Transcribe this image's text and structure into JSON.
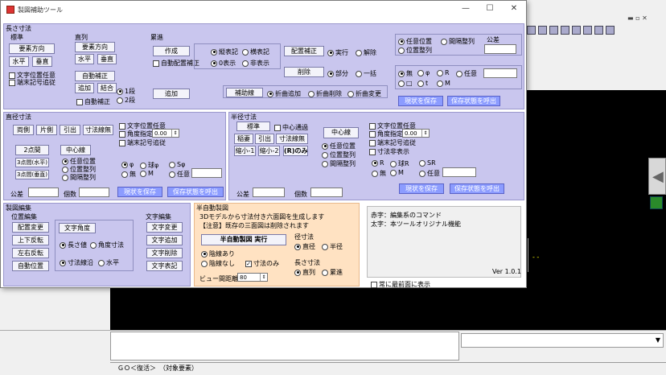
{
  "window": {
    "title": "製図補助ツール",
    "version": "Ver 1.0.1"
  },
  "status_bar": {
    "text": "ＧＯ＜復活＞　（対象要素）"
  },
  "length": {
    "header": "長さ寸法",
    "std": {
      "label": "標準",
      "dir": "要素方向",
      "horiz": "水平",
      "vert": "垂直",
      "text_pos": "文字位置任意",
      "end_mark": "端末記号追従"
    },
    "series": {
      "label": "直列",
      "dir": "要素方向",
      "horiz": "水平",
      "vert": "垂直",
      "auto": "自動補正",
      "add": "追加",
      "merge": "結合",
      "auto_corr": "自動補正",
      "r1": "1段",
      "r2": "2段"
    },
    "cumul": {
      "label": "累進",
      "create": "作成",
      "auto_align": "自動配置補正",
      "v_notation": "縦表記",
      "h_notation": "横表記",
      "zero_show": "0表示",
      "no_show": "非表示",
      "add": "追加",
      "align_corr": "配置補正",
      "exec": "実行",
      "release": "解除",
      "delete": "削除",
      "partial": "部分",
      "all": "一括",
      "aux": "補助線",
      "fold_add": "折曲追加",
      "fold_del": "折曲削除",
      "fold_mod": "折曲変更"
    },
    "pos": {
      "any": "任意位置",
      "interval": "間隔整列",
      "align": "位置整列",
      "tol_label": "公差"
    },
    "prefix": {
      "none": "無",
      "phi": "φ",
      "r": "R",
      "any": "任意",
      "sq": "□",
      "t": "t",
      "m": "M"
    },
    "save": "現状を保存",
    "load": "保存状態を呼出"
  },
  "diameter": {
    "header": "直径寸法",
    "b1": "両側",
    "b2": "片側",
    "b3": "引出",
    "b4": "寸法線無",
    "text_pos": "文字位置任意",
    "angle": "角度指定",
    "angle_val": "0.00",
    "end_mark": "端末記号追従",
    "pt2": "2点間",
    "pt3h": "3点間(水平)",
    "pt3v": "3点間(垂直)",
    "center_line": "中心線",
    "any": "任意位置",
    "align": "位置整列",
    "interval": "間隔整列",
    "phi": "φ",
    "sphere_phi": "球φ",
    "s_phi": "Sφ",
    "none": "無",
    "m": "M",
    "any_pref": "任意",
    "tol_label": "公差",
    "count_label": "個数",
    "save": "現状を保存",
    "load": "保存状態を呼出"
  },
  "radius": {
    "header": "半径寸法",
    "std": "標準",
    "center_pass": "中心通過",
    "fold": "稲妻",
    "leader": "引出",
    "no_line": "寸法線無",
    "shrink1": "縮小-1",
    "shrink2": "縮小-2",
    "r_only": "(R)のみ",
    "center_line": "中心線",
    "text_pos": "文字位置任意",
    "angle": "角度指定",
    "angle_val": "0.00",
    "end_mark": "端末記号追従",
    "no_show": "寸法非表示",
    "any": "任意位置",
    "align": "位置整列",
    "interval": "間隔整列",
    "r": "R",
    "sphere_r": "球R",
    "sr": "SR",
    "none": "無",
    "m": "M",
    "any_pref": "任意",
    "tol_label": "公差",
    "count_label": "個数",
    "save": "現状を保存",
    "load": "保存状態を呼出"
  },
  "edit": {
    "header": "製図編集",
    "pos_label": "位置編集",
    "align_mod": "配置変更",
    "vflip": "上下反転",
    "hflip": "左右反転",
    "auto_pos": "自動位置",
    "text_angle": "文字角度",
    "len_val": "長さ値",
    "angle_dim": "角度寸法",
    "dim_line": "寸法線沿",
    "horiz": "水平",
    "text_label": "文字編集",
    "text_mod": "文字変更",
    "text_add": "文字追加",
    "text_del": "文字削除",
    "text_notation": "文字表記"
  },
  "semi_auto": {
    "header": "半自動製図",
    "desc1": "3Dモデルから寸法付き六面図を生成します",
    "desc2": "【注意】既存の三面図は削除されます",
    "run": "半自動製図 実行",
    "hidden_yes": "陰線あり",
    "hidden_no": "陰線なし",
    "dim_only": "寸法のみ",
    "dia_label": "径寸法",
    "dia_dia": "直径",
    "dia_rad": "半径",
    "len_label": "長さ寸法",
    "len_series": "直列",
    "len_cumul": "累進",
    "view_dist_label": "ビュー間距離",
    "view_dist_val": "80"
  },
  "info": {
    "line1": "赤字：編集系のコマンド",
    "line2": "太字：本ツールオリジナル機能",
    "always_top": "常に最前面に表示"
  }
}
